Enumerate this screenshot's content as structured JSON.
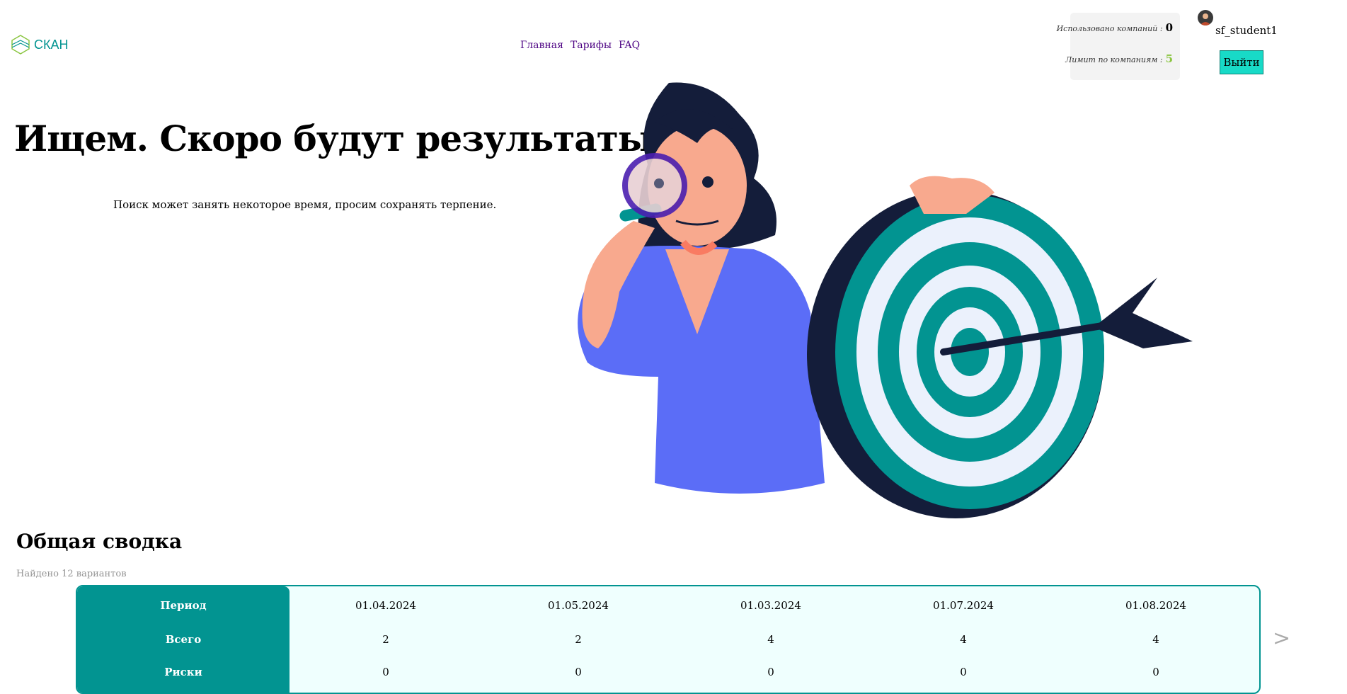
{
  "header": {
    "logo_text": "СКАН",
    "nav": [
      "Главная",
      "Тарифы",
      "FAQ"
    ],
    "limits": {
      "used_label": "Использовано компаний :",
      "used_value": "0",
      "limit_label": "Лимит по компаниям :",
      "limit_value": "5"
    },
    "user": {
      "name": "sf_student1",
      "logout_label": "Выйти"
    }
  },
  "hero": {
    "title": "Ищем. Скоро будут результаты",
    "subtitle": "Поиск может занять некоторое время, просим сохранять терпение."
  },
  "summary": {
    "title": "Общая сводка",
    "found_text": "Найдено 12 вариантов",
    "row_labels": [
      "Период",
      "Всего",
      "Риски"
    ],
    "columns": [
      {
        "period": "01.04.2024",
        "total": "2",
        "risks": "0"
      },
      {
        "period": "01.05.2024",
        "total": "2",
        "risks": "0"
      },
      {
        "period": "01.03.2024",
        "total": "4",
        "risks": "0"
      },
      {
        "period": "01.07.2024",
        "total": "4",
        "risks": "0"
      },
      {
        "period": "01.08.2024",
        "total": "4",
        "risks": "0"
      }
    ],
    "next_arrow": ">"
  },
  "colors": {
    "accent": "#029491",
    "logout_button": "#18dac7",
    "table_bg": "#effffe"
  }
}
